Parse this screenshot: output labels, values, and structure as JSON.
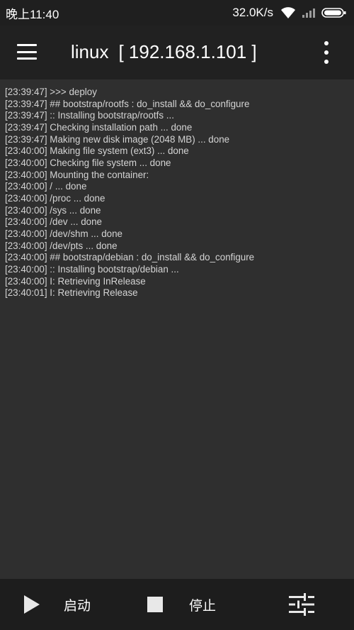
{
  "status_bar": {
    "time": "晚上11:40",
    "net_speed": "32.0K/s",
    "icons": [
      "wifi-icon",
      "signal-icon",
      "battery-icon"
    ]
  },
  "app_bar": {
    "title_host": "linux",
    "title_ip": "[ 192.168.1.101 ]",
    "icons": [
      "menu-icon",
      "more-vert-icon"
    ]
  },
  "log": {
    "lines": [
      "[23:39:47] >>> deploy",
      "[23:39:47] ## bootstrap/rootfs : do_install && do_configure",
      "[23:39:47] :: Installing bootstrap/rootfs ...",
      "[23:39:47] Checking installation path ... done",
      "[23:39:47] Making new disk image (2048 MB) ... done",
      "[23:40:00] Making file system (ext3) ... done",
      "[23:40:00] Checking file system ... done",
      "[23:40:00] Mounting the container:",
      "[23:40:00] / ... done",
      "[23:40:00] /proc ... done",
      "[23:40:00] /sys ... done",
      "[23:40:00] /dev ... done",
      "[23:40:00] /dev/shm ... done",
      "[23:40:00] /dev/pts ... done",
      "[23:40:00] ## bootstrap/debian : do_install && do_configure",
      "[23:40:00] :: Installing bootstrap/debian ...",
      "[23:40:00] I: Retrieving InRelease",
      "[23:40:01] I: Retrieving Release"
    ]
  },
  "bottom_bar": {
    "start_label": "启动",
    "stop_label": "停止",
    "icons": [
      "play-icon",
      "stop-icon",
      "tune-icon"
    ]
  },
  "colors": {
    "status_bar_bg": "#1f1f1f",
    "app_bar_bg": "#212121",
    "log_bg": "#2f2f2f",
    "bottom_bar_bg": "#1d1d1d",
    "log_text": "#d4d4d4"
  }
}
